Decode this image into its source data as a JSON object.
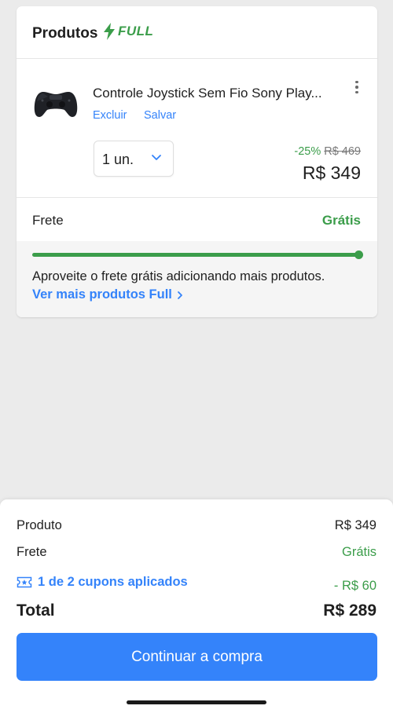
{
  "products_card": {
    "title": "Produtos",
    "badge_label": "FULL",
    "badge_icon": "lightning-bolt-icon",
    "accent_green": "#3b9d4a",
    "accent_blue": "#3483fa"
  },
  "product": {
    "image_icon": "gamepad-icon",
    "title": "Controle Joystick Sem Fio Sony Play...",
    "delete_label": "Excluir",
    "save_label": "Salvar",
    "quantity": "1 un.",
    "discount": "-25%",
    "original_price": "R$ 469",
    "price": "R$ 349"
  },
  "shipping": {
    "label": "Frete",
    "value": "Grátis",
    "progress_fraction": 1.0,
    "promo_text": "Aproveite o frete grátis adicionando mais produtos.",
    "promo_link": "Ver mais produtos Full"
  },
  "summary": {
    "product_label": "Produto",
    "product_value": "R$ 349",
    "shipping_label": "Frete",
    "shipping_value": "Grátis",
    "coupon_icon": "ticket-icon",
    "coupon_label": "1 de 2 cupons aplicados",
    "coupon_value": "- R$ 60",
    "total_label": "Total",
    "total_value": "R$ 289",
    "cta_label": "Continuar a compra"
  }
}
